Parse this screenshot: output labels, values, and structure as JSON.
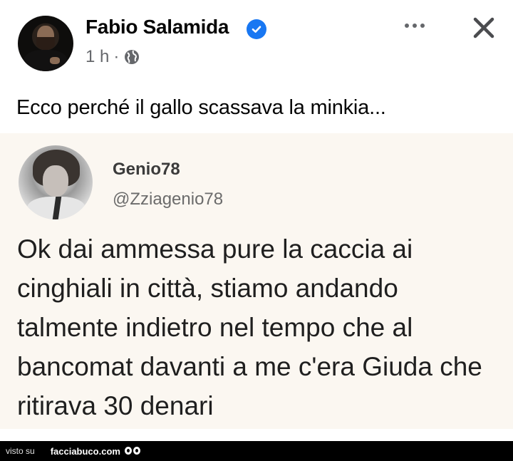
{
  "post": {
    "author": "Fabio Salamida",
    "time": "1 h",
    "separator": "·",
    "text": "Ecco perché il gallo scassava la minkia..."
  },
  "tweet": {
    "name": "Genio78",
    "handle": "@Zziagenio78",
    "text": "Ok dai ammessa pure la caccia ai cinghiali in città, stiamo andando talmente indietro nel tempo che al bancomat davanti a me c'era Giuda che ritirava 30 denari"
  },
  "footer": {
    "prefix": "visto su",
    "site": "facciabuco.com"
  },
  "colors": {
    "verified": "#1877f2",
    "meta": "#65676b",
    "tweet_background": "#fbf7f1"
  }
}
